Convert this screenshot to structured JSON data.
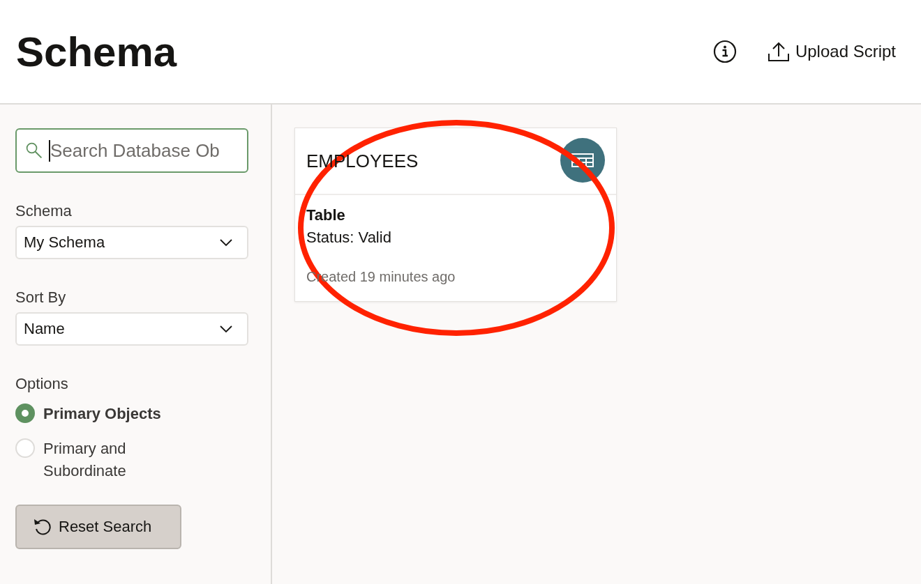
{
  "header": {
    "title": "Schema",
    "upload_label": "Upload Script"
  },
  "sidebar": {
    "search": {
      "placeholder": "Search Database Ob"
    },
    "schema": {
      "label": "Schema",
      "value": "My Schema"
    },
    "sort": {
      "label": "Sort By",
      "value": "Name"
    },
    "options": {
      "label": "Options",
      "items": [
        {
          "label": "Primary Objects",
          "selected": true
        },
        {
          "label": "Primary and Subordinate",
          "selected": false
        }
      ]
    },
    "reset_label": "Reset Search"
  },
  "cards": [
    {
      "name": "EMPLOYEES",
      "type": "Table",
      "status": "Status: Valid",
      "created": "Created 19 minutes ago",
      "highlighted": true
    }
  ]
}
